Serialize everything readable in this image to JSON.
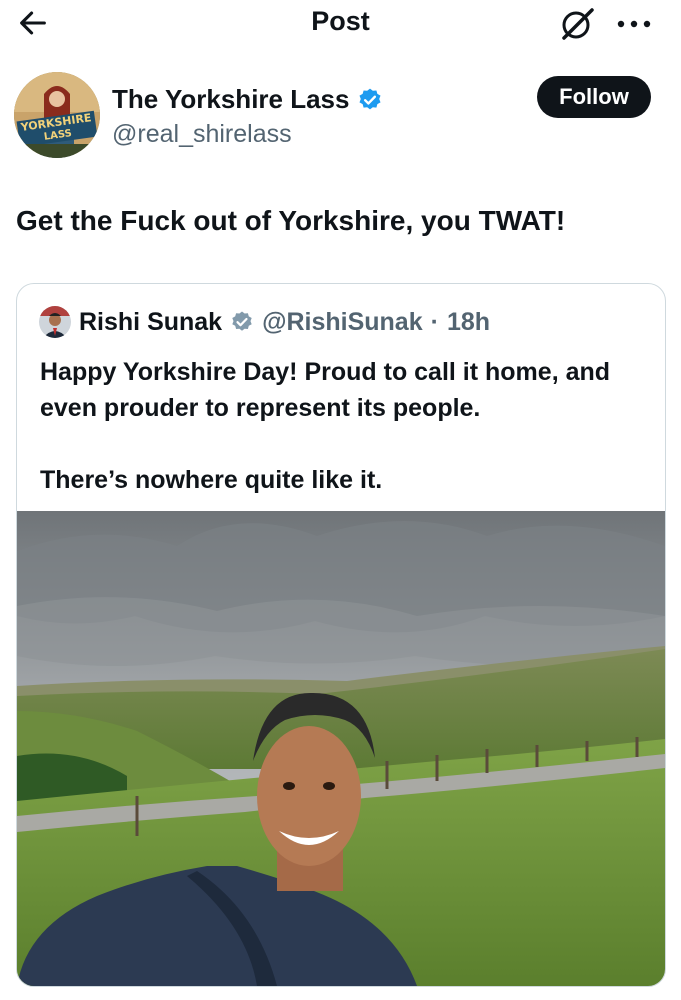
{
  "topbar": {
    "title": "Post",
    "back_icon": "back-arrow-icon",
    "grok_icon": "grok-icon",
    "more_icon": "more-options-icon"
  },
  "author": {
    "name": "The Yorkshire Lass",
    "handle": "@real_shirelass",
    "verified": true,
    "avatar_text": "YORKSHIRE LASS"
  },
  "follow_label": "Follow",
  "post_text": "Get the Fuck out of Yorkshire, you TWAT!",
  "quoted": {
    "name": "Rishi Sunak",
    "handle": "@RishiSunak",
    "separator": "·",
    "time": "18h",
    "paragraphs": [
      "Happy Yorkshire Day! Proud to call it home, and even prouder to represent its people.",
      "There’s nowhere quite like it."
    ]
  },
  "colors": {
    "text": "#0f1419",
    "secondary_text": "#536471",
    "verified_blue": "#1d9bf0",
    "verified_grey": "#829aab",
    "border": "#cfd9de"
  }
}
